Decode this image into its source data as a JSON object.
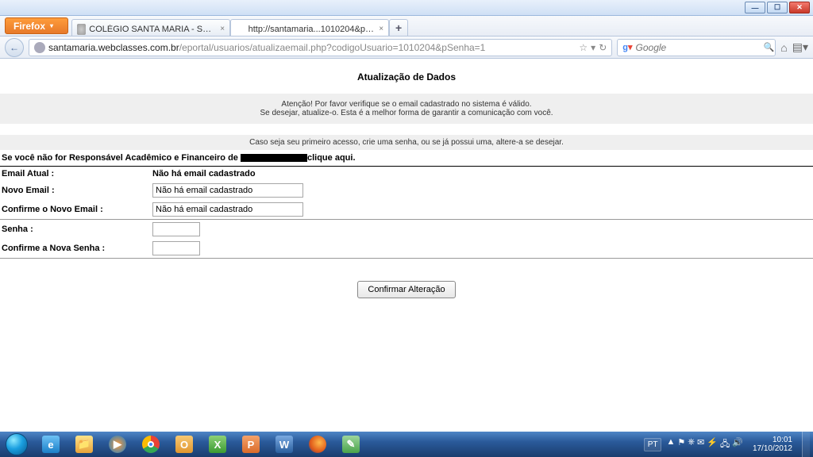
{
  "window": {
    "firefox_label": "Firefox"
  },
  "tabs": {
    "tab1": "COLÉGIO SANTA MARIA - SÃO PAULO",
    "tab2": "http://santamaria...1010204&pSenha=1"
  },
  "nav": {
    "url_host": "santamaria.webclasses.com.br",
    "url_path": "/eportal/usuarios/atualizaemail.php?codigoUsuario=1010204&pSenha=1",
    "search_placeholder": "Google"
  },
  "page": {
    "title": "Atualização de Dados",
    "banner_line1": "Atenção! Por favor verifique se o email cadastrado no sistema é válido.",
    "banner_line2": "Se desejar, atualize-o. Esta é a melhor forma de garantir a comunicação com você.",
    "banner2": "Caso seja seu primeiro acesso, crie uma senha, ou se já possui uma, altere-a se desejar.",
    "instr_prefix": "Se você não for Responsável Acadêmico e Financeiro de ",
    "instr_suffix": "clique aqui.",
    "labels": {
      "email_atual": "Email Atual :",
      "novo_email": "Novo Email :",
      "confirme_email": "Confirme o Novo Email :",
      "senha": "Senha :",
      "confirme_senha": "Confirme a Nova Senha :"
    },
    "values": {
      "email_atual": "Não há email cadastrado",
      "novo_email": "Não há email cadastrado",
      "confirme_email": "Não há email cadastrado"
    },
    "submit": "Confirmar Alteração"
  },
  "taskbar": {
    "lang": "PT",
    "time": "10:01",
    "date": "17/10/2012"
  }
}
